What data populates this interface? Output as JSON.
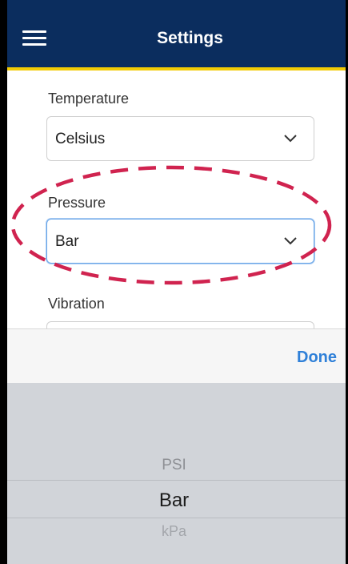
{
  "header": {
    "title": "Settings",
    "menu_icon": "hamburger-menu-icon",
    "background": "#0b2d5e",
    "accent": "#f2cb05"
  },
  "fields": {
    "temperature": {
      "label": "Temperature",
      "value": "Celsius"
    },
    "pressure": {
      "label": "Pressure",
      "value": "Bar"
    },
    "vibration": {
      "label": "Vibration",
      "value": ""
    }
  },
  "highlight": {
    "color": "#d0234f",
    "style": "dashed"
  },
  "picker": {
    "done_label": "Done",
    "done_color": "#2f80d8",
    "options": [
      "PSI",
      "Bar",
      "kPa"
    ],
    "selected": "Bar"
  }
}
